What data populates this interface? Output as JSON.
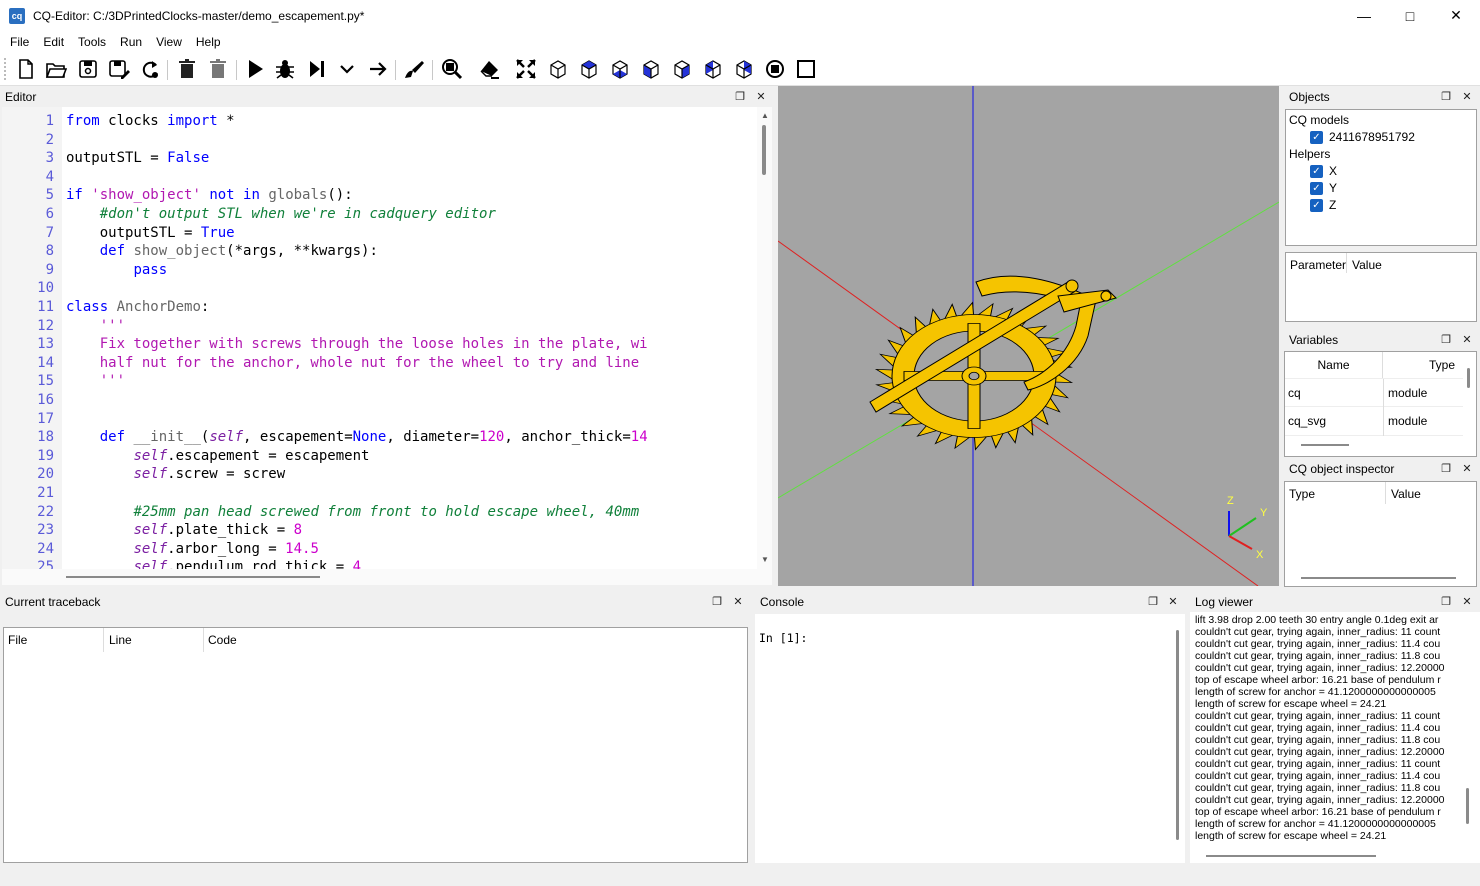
{
  "window": {
    "title": "CQ-Editor: C:/3DPrintedClocks-master/demo_escapement.py*",
    "app_icon": "cq"
  },
  "menu": [
    "File",
    "Edit",
    "Tools",
    "Run",
    "View",
    "Help"
  ],
  "toolbar_icons": [
    "new-file-icon",
    "open-folder-icon",
    "save-icon",
    "save-as-icon",
    "reload-icon",
    "delete-icon",
    "delete-all-icon",
    "run-icon",
    "debug-icon",
    "step-icon",
    "step-in-icon",
    "continue-icon",
    "clear-icon",
    "fit-icon",
    "eraser-icon",
    "fit-all-icon",
    "iso-view-icon",
    "top-view-icon",
    "bottom-view-icon",
    "front-view-icon",
    "back-view-icon",
    "left-view-icon",
    "right-view-icon",
    "wireframe-icon",
    "shaded-icon"
  ],
  "editor": {
    "title": "Editor",
    "lines": [
      "from clocks import *",
      "",
      "outputSTL = False",
      "",
      "if 'show_object' not in globals():",
      "    #don't output STL when we're in cadquery editor",
      "    outputSTL = True",
      "    def show_object(*args, **kwargs):",
      "        pass",
      "",
      "class AnchorDemo:",
      "    '''",
      "    Fix together with screws through the loose holes in the plate, wi",
      "    half nut for the anchor, whole nut for the wheel to try and line",
      "    '''",
      "",
      "",
      "    def __init__(self, escapement=None, diameter=120, anchor_thick=14",
      "        self.escapement = escapement",
      "        self.screw = screw",
      "",
      "        #25mm pan head screwed from front to hold escape wheel, 40mm",
      "        self.plate_thick = 8",
      "        self.arbor_long = 14.5",
      "        self.pendulum_rod_thick = 4"
    ]
  },
  "objects": {
    "title": "Objects",
    "groups": [
      {
        "label": "CQ models",
        "items": [
          "2411678951792"
        ]
      },
      {
        "label": "Helpers",
        "items": [
          "X",
          "Y",
          "Z"
        ]
      }
    ],
    "param_headers": [
      "Parameter",
      "Value"
    ]
  },
  "variables": {
    "title": "Variables",
    "headers": [
      "Name",
      "Type"
    ],
    "rows": [
      [
        "cq",
        "module"
      ],
      [
        "cq_svg",
        "module"
      ]
    ]
  },
  "inspector": {
    "title": "CQ object inspector",
    "headers": [
      "Type",
      "Value"
    ]
  },
  "traceback": {
    "title": "Current traceback",
    "headers": [
      "File",
      "Line",
      "Code"
    ]
  },
  "console": {
    "title": "Console",
    "prompt": "In [1]:"
  },
  "log": {
    "title": "Log viewer",
    "lines": [
      "lift 3.98 drop 2.00 teeth 30 entry angle 0.1deg exit ar",
      "couldn't cut gear, trying again, inner_radius: 11 count",
      "couldn't cut gear, trying again, inner_radius: 11.4 cou",
      "couldn't cut gear, trying again, inner_radius: 11.8 cou",
      "couldn't cut gear, trying again, inner_radius: 12.20000",
      "top of escape wheel arbor: 16.21 base of pendulum r",
      "length of screw for anchor = 41.1200000000000005",
      "length of screw for escape wheel = 24.21",
      "couldn't cut gear, trying again, inner_radius: 11 count",
      "couldn't cut gear, trying again, inner_radius: 11.4 cou",
      "couldn't cut gear, trying again, inner_radius: 11.8 cou",
      "couldn't cut gear, trying again, inner_radius: 12.20000",
      "couldn't cut gear, trying again, inner_radius: 11 count",
      "couldn't cut gear, trying again, inner_radius: 11.4 cou",
      "couldn't cut gear, trying again, inner_radius: 11.8 cou",
      "couldn't cut gear, trying again, inner_radius: 12.20000",
      "top of escape wheel arbor: 16.21 base of pendulum r",
      "length of screw for anchor = 41.1200000000000005",
      "length of screw for escape wheel = 24.21"
    ]
  },
  "axes": {
    "x": "X",
    "y": "Y",
    "z": "Z"
  },
  "colors": {
    "accent": "#1561c0",
    "model": "#f5c400",
    "viewport_bg": "#a4a4a4"
  }
}
